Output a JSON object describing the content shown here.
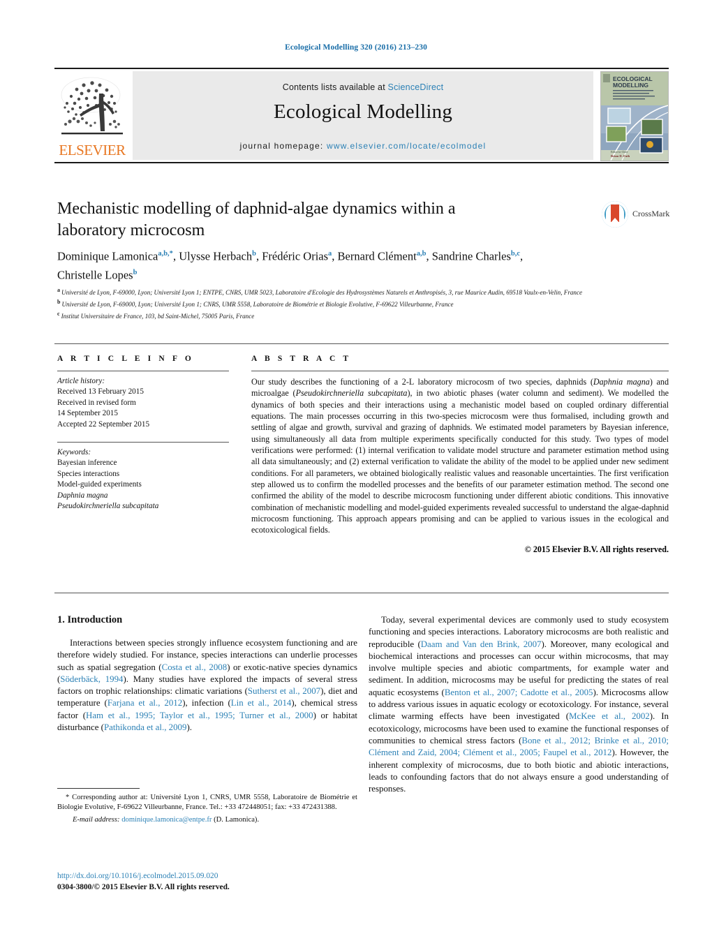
{
  "running_head": "Ecological Modelling 320 (2016) 213–230",
  "masthead": {
    "publisher_logo_label": "ELSEVIER",
    "contents_prefix": "Contents lists available at ",
    "contents_link": "ScienceDirect",
    "journal_title": "Ecological Modelling",
    "homepage_prefix": "journal homepage: ",
    "homepage_url": "www.elsevier.com/locate/ecolmodel",
    "cover_title_line1": "ECOLOGICAL",
    "cover_title_line2": "MODELLING"
  },
  "article": {
    "title": "Mechanistic modelling of daphnid-algae dynamics within a laboratory microcosm",
    "crossmark_label": "CrossMark",
    "authors_line1": "Dominique Lamonica",
    "authors_line1_sup": "a,b,*",
    "authors": [
      {
        "name": "Dominique Lamonica",
        "sup": "a,b,*"
      },
      {
        "name": "Ulysse Herbach",
        "sup": "b"
      },
      {
        "name": "Frédéric Orias",
        "sup": "a"
      },
      {
        "name": "Bernard Clément",
        "sup": "a,b"
      },
      {
        "name": "Sandrine Charles",
        "sup": "b,c"
      },
      {
        "name": "Christelle Lopes",
        "sup": "b"
      }
    ],
    "affiliations": [
      {
        "sup": "a",
        "text": "Université de Lyon, F-69000, Lyon; Université Lyon 1; ENTPE, CNRS, UMR 5023, Laboratoire d'Ecologie des Hydrosystèmes Naturels et Anthropisés, 3, rue Maurice Audin, 69518 Vaulx-en-Velin, France"
      },
      {
        "sup": "b",
        "text": "Université de Lyon, F-69000, Lyon; Université Lyon 1; CNRS, UMR 5558, Laboratoire de Biométrie et Biologie Evolutive, F-69622 Villeurbanne, France"
      },
      {
        "sup": "c",
        "text": "Institut Universitaire de France, 103, bd Saint-Michel, 75005 Paris, France"
      }
    ]
  },
  "article_info": {
    "heading": "A R T I C L E   I N F O",
    "history_label": "Article history:",
    "history": [
      "Received 13 February 2015",
      "Received in revised form",
      "14 September 2015",
      "Accepted 22 September 2015"
    ],
    "keywords_label": "Keywords:",
    "keywords": [
      {
        "text": "Bayesian inference",
        "italic": false
      },
      {
        "text": "Species interactions",
        "italic": false
      },
      {
        "text": "Model-guided experiments",
        "italic": false
      },
      {
        "text": "Daphnia magna",
        "italic": true
      },
      {
        "text": "Pseudokirchneriella subcapitata",
        "italic": true
      }
    ]
  },
  "abstract": {
    "heading": "A B S T R A C T",
    "text_p1": "Our study describes the functioning of a 2-L laboratory microcosm of two species, daphnids (",
    "species1": "Daphnia magna",
    "text_p2": ") and microalgae (",
    "species2": "Pseudokirchneriella subcapitata",
    "text_p3": "), in two abiotic phases (water column and sediment). We modelled the dynamics of both species and their interactions using a mechanistic model based on coupled ordinary differential equations. The main processes occurring in this two-species microcosm were thus formalised, including growth and settling of algae and growth, survival and grazing of daphnids. We estimated model parameters by Bayesian inference, using simultaneously all data from multiple experiments specifically conducted for this study. Two types of model verifications were performed: (1) internal verification to validate model structure and parameter estimation method using all data simultaneously; and (2) external verification to validate the ability of the model to be applied under new sediment conditions. For all parameters, we obtained biologically realistic values and reasonable uncertainties. The first verification step allowed us to confirm the modelled processes and the benefits of our parameter estimation method. The second one confirmed the ability of the model to describe microcosm functioning under different abiotic conditions. This innovative combination of mechanistic modelling and model-guided experiments revealed successful to understand the algae-daphnid microcosm functioning. This approach appears promising and can be applied to various issues in the ecological and ecotoxicological fields.",
    "copyright": "© 2015 Elsevier B.V. All rights reserved."
  },
  "introduction": {
    "heading": "1.  Introduction",
    "left_paragraph_parts": [
      {
        "t": "Interactions between species strongly influence ecosystem functioning and are therefore widely studied. For instance, species interactions can underlie processes such as spatial segregation (",
        "c": false
      },
      {
        "t": "Costa et al., 2008",
        "c": true
      },
      {
        "t": ") or exotic-native species dynamics (",
        "c": false
      },
      {
        "t": "Söderbäck, 1994",
        "c": true
      },
      {
        "t": "). Many studies have explored the impacts of several stress factors on trophic relationships: climatic variations (",
        "c": false
      },
      {
        "t": "Sutherst et al., 2007",
        "c": true
      },
      {
        "t": "), diet and temperature (",
        "c": false
      },
      {
        "t": "Farjana et al., 2012",
        "c": true
      },
      {
        "t": "), infection (",
        "c": false
      },
      {
        "t": "Lin et al., 2014",
        "c": true
      },
      {
        "t": "), chemical stress factor (",
        "c": false
      },
      {
        "t": "Ham et al., 1995; Taylor et al., 1995; Turner et al., 2000",
        "c": true
      },
      {
        "t": ") or habitat disturbance (",
        "c": false
      },
      {
        "t": "Pathikonda et al., 2009",
        "c": true
      },
      {
        "t": ").",
        "c": false
      }
    ],
    "right_paragraph_parts": [
      {
        "t": "Today, several experimental devices are commonly used to study ecosystem functioning and species interactions. Laboratory microcosms are both realistic and reproducible (",
        "c": false
      },
      {
        "t": "Daam and Van den Brink, 2007",
        "c": true
      },
      {
        "t": "). Moreover, many ecological and biochemical interactions and processes can occur within microcosms, that may involve multiple species and abiotic compartments, for example water and sediment. In addition, microcosms may be useful for predicting the states of real aquatic ecosystems (",
        "c": false
      },
      {
        "t": "Benton et al., 2007; Cadotte et al., 2005",
        "c": true
      },
      {
        "t": "). Microcosms allow to address various issues in aquatic ecology or ecotoxicology. For instance, several climate warming effects have been investigated (",
        "c": false
      },
      {
        "t": "McKee et al., 2002",
        "c": true
      },
      {
        "t": "). In ecotoxicology, microcosms have been used to examine the functional responses of communities to chemical stress factors (",
        "c": false
      },
      {
        "t": "Bone et al., 2012; Brinke et al., 2010; Clément and Zaid, 2004; Clément et al., 2005; Faupel et al., 2012",
        "c": true
      },
      {
        "t": "). However, the inherent complexity of microcosms, due to both biotic and abiotic interactions, leads to confounding factors that do not always ensure a good understanding of responses.",
        "c": false
      }
    ]
  },
  "footnotes": {
    "corresponding": "*  Corresponding author at: Université Lyon 1, CNRS, UMR 5558, Laboratoire de Biométrie et Biologie Evolutive, F-69622 Villeurbanne, France. Tel.: +33 472448051; fax: +33 472431388.",
    "email_label": "E-mail address:",
    "email": "dominique.lamonica@entpe.fr",
    "email_suffix": "(D. Lamonica).",
    "doi": "http://dx.doi.org/10.1016/j.ecolmodel.2015.09.020",
    "issn_line": "0304-3800/© 2015 Elsevier B.V. All rights reserved."
  },
  "colors": {
    "link_blue": "#2b80b5",
    "elsevier_orange": "#e87722",
    "band_gray": "#eaeaea",
    "crossmark_blue": "#3c9ac4",
    "crossmark_red": "#d9472b"
  }
}
